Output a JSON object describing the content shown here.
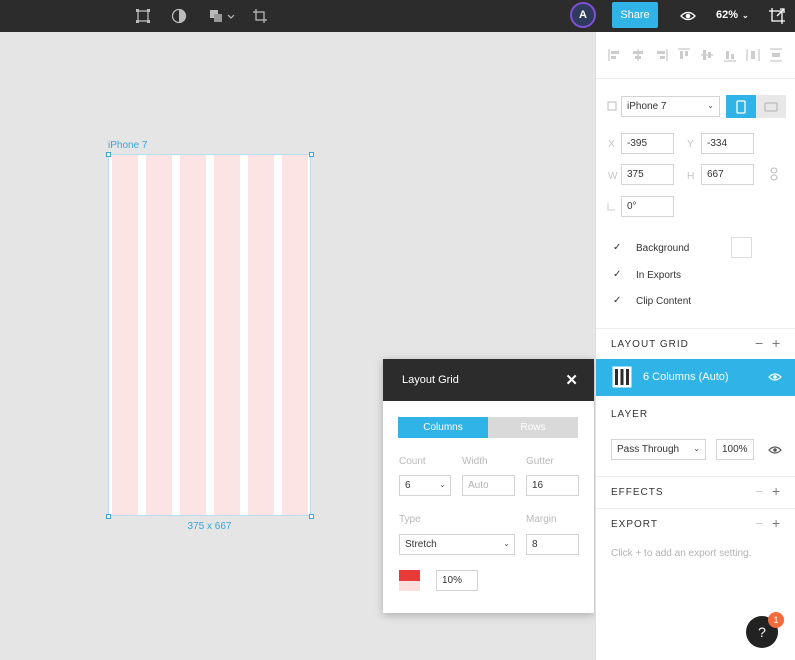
{
  "topbar": {
    "avatar_initial": "A",
    "share_label": "Share",
    "zoom_value": "62%",
    "icons": [
      "frame-icon",
      "contrast-icon",
      "boolean-icon",
      "crop-icon",
      "eye-icon",
      "resize-icon"
    ]
  },
  "canvas": {
    "frame_name": "iPhone 7",
    "frame_size": "375 x 667"
  },
  "layout_grid_popup": {
    "title": "Layout Grid",
    "tabs": {
      "columns": "Columns",
      "rows": "Rows"
    },
    "count_label": "Count",
    "count_value": "6",
    "width_label": "Width",
    "width_placeholder": "Auto",
    "gutter_label": "Gutter",
    "gutter_value": "16",
    "type_label": "Type",
    "type_value": "Stretch",
    "margin_label": "Margin",
    "margin_value": "8",
    "color": "#e93a3a",
    "opacity_value": "10%"
  },
  "panel": {
    "device": "iPhone 7",
    "x_label": "X",
    "x_value": "-395",
    "y_label": "Y",
    "y_value": "-334",
    "w_label": "W",
    "w_value": "375",
    "h_label": "H",
    "h_value": "667",
    "rotation_value": "0°",
    "checks": {
      "background": "Background",
      "in_exports": "In Exports",
      "clip_content": "Clip Content"
    },
    "layout_grid_title": "LAYOUT GRID",
    "grid_item": "6 Columns (Auto)",
    "layer_title": "LAYER",
    "blend_mode": "Pass Through",
    "layer_opacity": "100%",
    "effects_title": "EFFECTS",
    "export_title": "EXPORT",
    "export_hint": "Click + to add an export setting."
  },
  "help": {
    "label": "?",
    "badge_count": "1"
  },
  "colors": {
    "accent": "#30b4e8",
    "topbar_bg": "#2c2c2c",
    "grid_column": "#fde4e4"
  }
}
